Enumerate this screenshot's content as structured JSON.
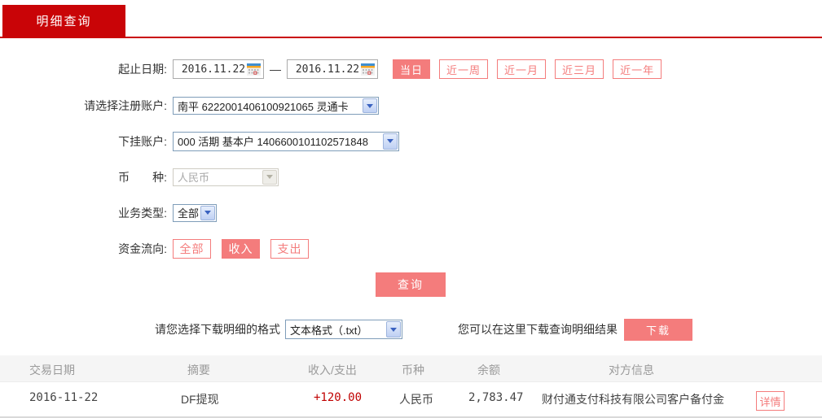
{
  "theme": {
    "brand_red": "#c90407",
    "salmon": "#f47c7c",
    "amount_positive_red": "#c00000",
    "table_header_bg": "#f5f5f5",
    "table_header_text": "#9a9a9a"
  },
  "tab": {
    "label": "明细查询"
  },
  "form": {
    "date_range": {
      "label": "起止日期:",
      "from": "2016.11.22",
      "to": "2016.11.22",
      "separator": "—",
      "calendar_icon": "calendar-icon",
      "quick_buttons": [
        {
          "label": "当日",
          "active": true
        },
        {
          "label": "近一周",
          "active": false
        },
        {
          "label": "近一月",
          "active": false
        },
        {
          "label": "近三月",
          "active": false
        },
        {
          "label": "近一年",
          "active": false
        }
      ]
    },
    "register_account": {
      "label": "请选择注册账户:",
      "value": "南平 6222001406100921065 灵通卡"
    },
    "sub_account": {
      "label": "下挂账户:",
      "value": "000 活期 基本户 1406600101102571848"
    },
    "currency": {
      "label": "币　　种:",
      "value": "人民币",
      "disabled": true
    },
    "business_type": {
      "label": "业务类型:",
      "value": "全部"
    },
    "fund_flow": {
      "label": "资金流向:",
      "options": [
        {
          "label": "全部",
          "active": false
        },
        {
          "label": "收入",
          "active": true
        },
        {
          "label": "支出",
          "active": false
        }
      ]
    },
    "query_button": "查询"
  },
  "download": {
    "format_label": "请您选择下载明细的格式",
    "format_value": "文本格式（.txt）",
    "hint": "您可以在这里下载查询明细结果",
    "button": "下载"
  },
  "table": {
    "headers": [
      "交易日期",
      "摘要",
      "收入/支出",
      "币种",
      "余额",
      "对方信息"
    ],
    "rows": [
      {
        "date": "2016-11-22",
        "summary": "DF提现",
        "amount": "+120.00",
        "currency": "人民币",
        "balance": "2,783.47",
        "counterparty": "财付通支付科技有限公司客户备付金",
        "detail_button": "详情"
      }
    ]
  }
}
